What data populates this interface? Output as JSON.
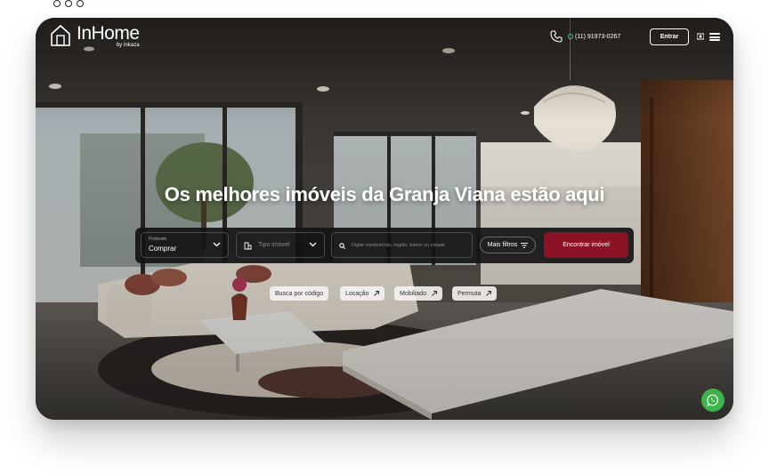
{
  "window_controls": [
    "window-dot-1",
    "window-dot-2",
    "window-dot-3"
  ],
  "brand": {
    "name": "InHome",
    "sub": "by Inkaza"
  },
  "header": {
    "phone": "(11) 91973-0267",
    "login_label": "Entrar"
  },
  "hero": {
    "headline": "Os melhores imóveis da Granja Viana estão aqui"
  },
  "search": {
    "purpose_label": "Pretendo",
    "purpose_value": "Comprar",
    "type_placeholder": "Tipo imóvel",
    "query_placeholder": "Digite condomínio, região, bairro ou cidade",
    "filters_label": "Mais filtros",
    "submit_label": "Encontrar imóvel"
  },
  "chips": [
    "Busca por código",
    "Locação",
    "Mobiliado",
    "Permuta"
  ],
  "colors": {
    "accent": "#8c1325",
    "whatsapp": "#3cb44a",
    "bar": "#141416"
  },
  "icons": [
    "home-logo-icon",
    "phone-icon",
    "whatsapp-icon",
    "flag-icon",
    "menu-icon",
    "chevron-down-icon",
    "building-icon",
    "search-icon",
    "filter-icon",
    "arrow-icon"
  ]
}
